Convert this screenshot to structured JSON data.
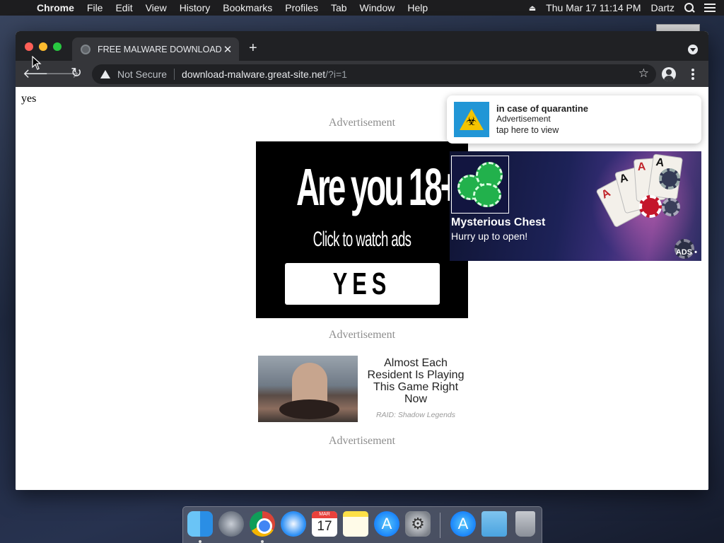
{
  "menubar": {
    "app_name": "Chrome",
    "menus": [
      "File",
      "Edit",
      "View",
      "History",
      "Bookmarks",
      "Profiles",
      "Tab",
      "Window",
      "Help"
    ],
    "clock": "Thu Mar 17  11:14 PM",
    "user": "Dartz"
  },
  "browser": {
    "tab_title": "FREE MALWARE DOWNLOAD",
    "security_label": "Not Secure",
    "url_host": "download-malware.great-site.net",
    "url_path": "/?i=1"
  },
  "page": {
    "body_text": "yes",
    "ad_label": "Advertisement",
    "age_ad": {
      "headline": "Are you 18+?",
      "subline": "Click to watch ads",
      "button": "YES"
    },
    "native_ad": {
      "headline": "Almost Each Resident Is Playing This Game Right Now",
      "source": "RAID: Shadow Legends"
    },
    "notification": {
      "title": "in case of quarantine",
      "subtitle": "Advertisement",
      "cta": "tap here to view",
      "icon": "biohazard-icon"
    },
    "casino_ad": {
      "title": "Mysterious Chest",
      "subtitle": "Hurry up to open!",
      "tag": "ADS"
    }
  },
  "dock": {
    "calendar_month": "MAR",
    "calendar_day": "17",
    "apps": [
      "finder-icon",
      "launchpad-icon",
      "chrome-icon",
      "safari-icon",
      "calendar-icon",
      "notes-icon",
      "app-store-icon",
      "system-preferences-icon",
      "app-store-icon",
      "downloads-folder-icon",
      "trash-icon"
    ]
  }
}
